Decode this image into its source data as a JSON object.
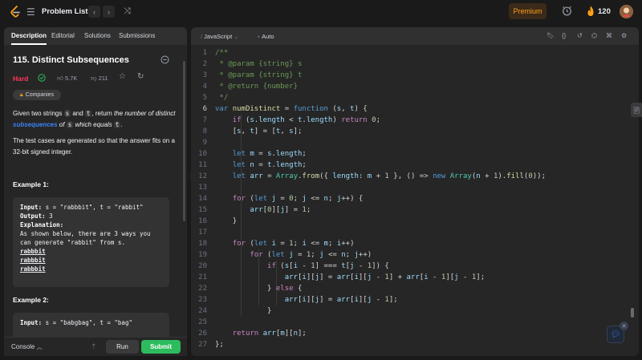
{
  "topbar": {
    "problem_list": "Problem List",
    "premium": "Premium",
    "streak": "120",
    "brand_color": "#ffa116"
  },
  "left": {
    "tabs": [
      "Description",
      "Editorial",
      "Solutions",
      "Submissions"
    ],
    "title": "115. Distinct Subsequences",
    "difficulty": "Hard",
    "likes": "5.7K",
    "dislikes": "211",
    "companies": "Companies",
    "desc1_a": "Given two strings ",
    "desc1_s": "s",
    "desc1_b": " and ",
    "desc1_t": "t",
    "desc1_c": ", return ",
    "desc1_d": "the number of distinct ",
    "desc1_link": "subsequences",
    "desc1_e": " of ",
    "desc1_s2": "s",
    "desc1_f": " which equals ",
    "desc1_t2": "t",
    "desc1_g": ".",
    "desc2": "The test cases are generated so that the answer fits on a 32-bit signed integer.",
    "ex1_title": "Example 1:",
    "ex1_input_label": "Input:",
    "ex1_input": " s = \"rabbbit\", t = \"rabbit\"",
    "ex1_output_label": "Output:",
    "ex1_output": " 3",
    "ex1_expl_label": "Explanation:",
    "ex1_expl": "As shown below, there are 3 ways you can generate \"rabbit\" from s.",
    "ex1_rows": [
      "rabbbit",
      "rabbbit",
      "rabbbit"
    ],
    "ex2_title": "Example 2:",
    "ex2_input_label": "Input:",
    "ex2_input": " s = \"babgbag\", t = \"bag\"",
    "console": "Console",
    "run": "Run",
    "submit": "Submit"
  },
  "editor": {
    "language": "JavaScript",
    "mode": "Auto",
    "active_line": 6,
    "lines": [
      "/**",
      " * @param {string} s",
      " * @param {string} t",
      " * @return {number}",
      " */",
      "var numDistinct = function (s, t) {",
      "    if (s.length < t.length) return 0;",
      "    [s, t] = [t, s];",
      "",
      "    let m = s.length;",
      "    let n = t.length;",
      "    let arr = Array.from({ length: m + 1 }, () => new Array(n + 1).fill(0));",
      "",
      "    for (let j = 0; j <= n; j++) {",
      "        arr[0][j] = 1;",
      "    }",
      "",
      "    for (let i = 1; i <= m; i++)",
      "        for (let j = 1; j <= n; j++)",
      "            if (s[i - 1] === t[j - 1]) {",
      "                arr[i][j] = arr[i][j - 1] + arr[i - 1][j - 1];",
      "            } else {",
      "                arr[i][j] = arr[i][j - 1];",
      "            }",
      "",
      "    return arr[m][n];",
      "};"
    ]
  }
}
